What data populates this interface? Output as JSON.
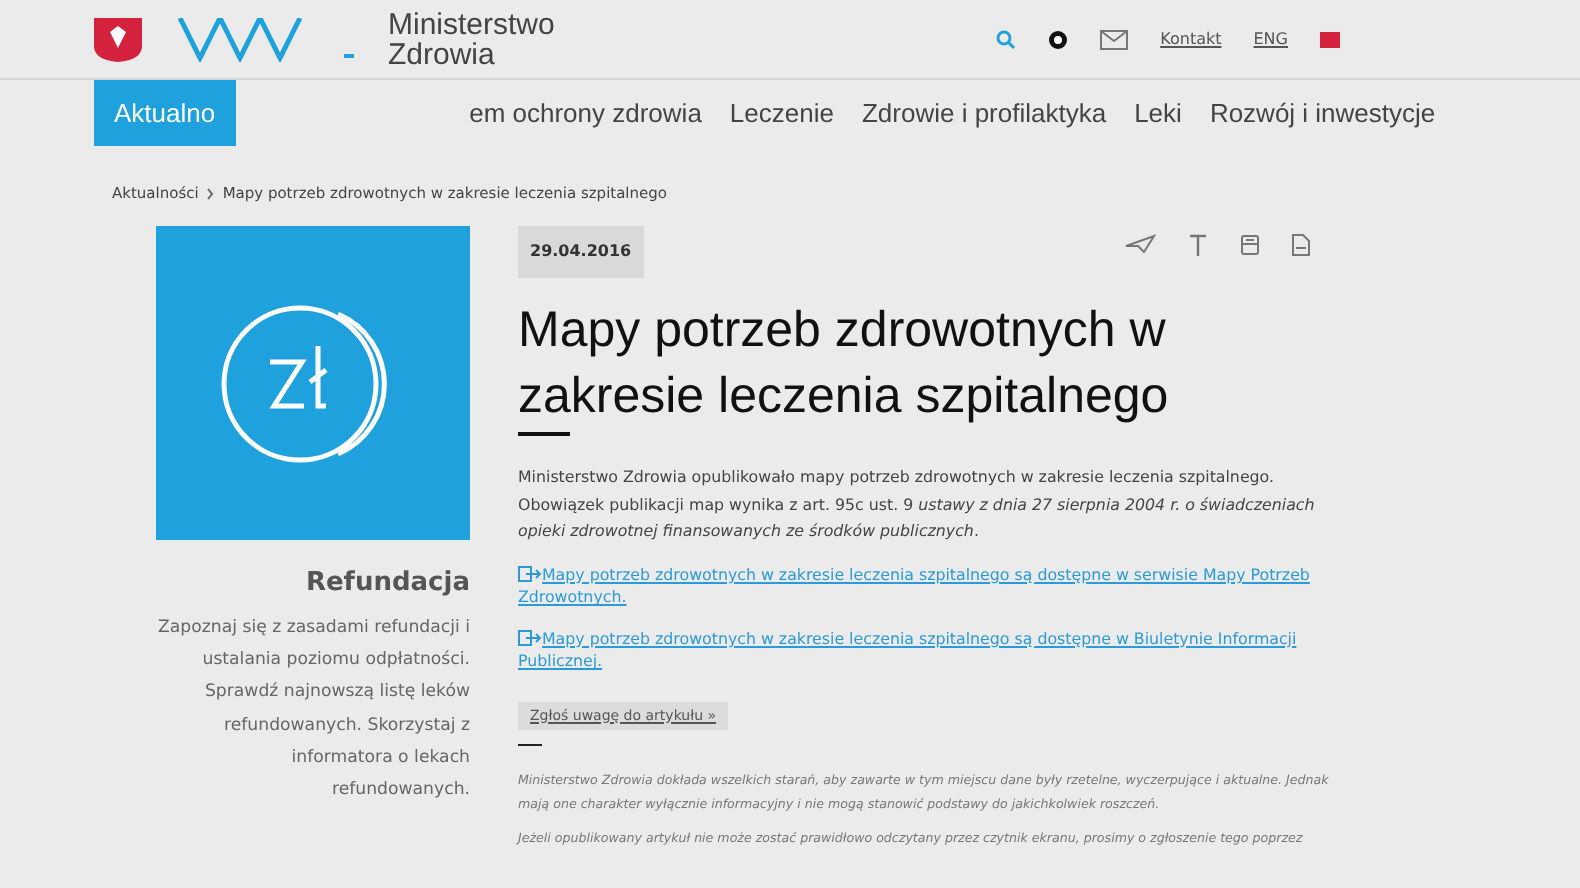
{
  "header": {
    "logo_line1": "Ministerstwo",
    "logo_line2": "Zdrowia",
    "links": [
      "Kontakt",
      "ENG"
    ]
  },
  "nav": [
    {
      "label": "Aktualno",
      "selected": true
    },
    {
      "label": "em ochrony zdrowia",
      "selected": false
    },
    {
      "label": "Leczenie",
      "selected": false
    },
    {
      "label": "Zdrowie i profilaktyka",
      "selected": false
    },
    {
      "label": "Leki",
      "selected": false
    },
    {
      "label": "Rozwój i inwestycje",
      "selected": false
    }
  ],
  "breadcrumb": [
    "Aktualności",
    "Mapy potrzeb zdrowotnych w zakresie leczenia szpitalnego"
  ],
  "sidebar": {
    "title": "Refundacja",
    "text": "Zapoznaj się z zasadami refundacji i ustalania poziomu odpłatności. Sprawdź najnowszą listę leków refundowanych. Skorzystaj z informatora o lekach refundowanych."
  },
  "article": {
    "date": "29.04.2016",
    "title": "Mapy potrzeb zdrowotnych w zakresie leczenia szpitalnego",
    "intro": "Ministerstwo Zdrowia opublikowało mapy potrzeb zdrowotnych w zakresie leczenia szpitalnego. Obowiązek publikacji map wynika z art. 95c ust. 9 *ustawy z dnia 27 sierpnia 2004 r. o świadczeniach opieki zdrowotnej finansowanych ze środków publicznych*.",
    "links": [
      "Mapy potrzeb zdrowotnych w zakresie leczenia szpitalnego są dostępne w serwisie Mapy Potrzeb Zdrowotnych.",
      "Mapy potrzeb zdrowotnych w zakresie leczenia szpitalnego są dostępne w Biuletynie Informacji Publicznej."
    ],
    "report_button": "Zgłoś uwagę do artykułu »",
    "disclaimer": "Ministerstwo Zdrowia dokłada wszelkich starań, aby zawarte w tym miejscu dane były rzetelne, wyczerpujące i aktualne. Jednak mają one charakter wyłącznie informacyjny i nie mogą stanowić podstawy do jakichkolwiek roszczeń.",
    "accessibility_note": "Jeżeli opublikowany artykuł nie może zostać prawidłowo odczytany przez czytnik ekranu, prosimy o zgłoszenie tego poprzez"
  }
}
